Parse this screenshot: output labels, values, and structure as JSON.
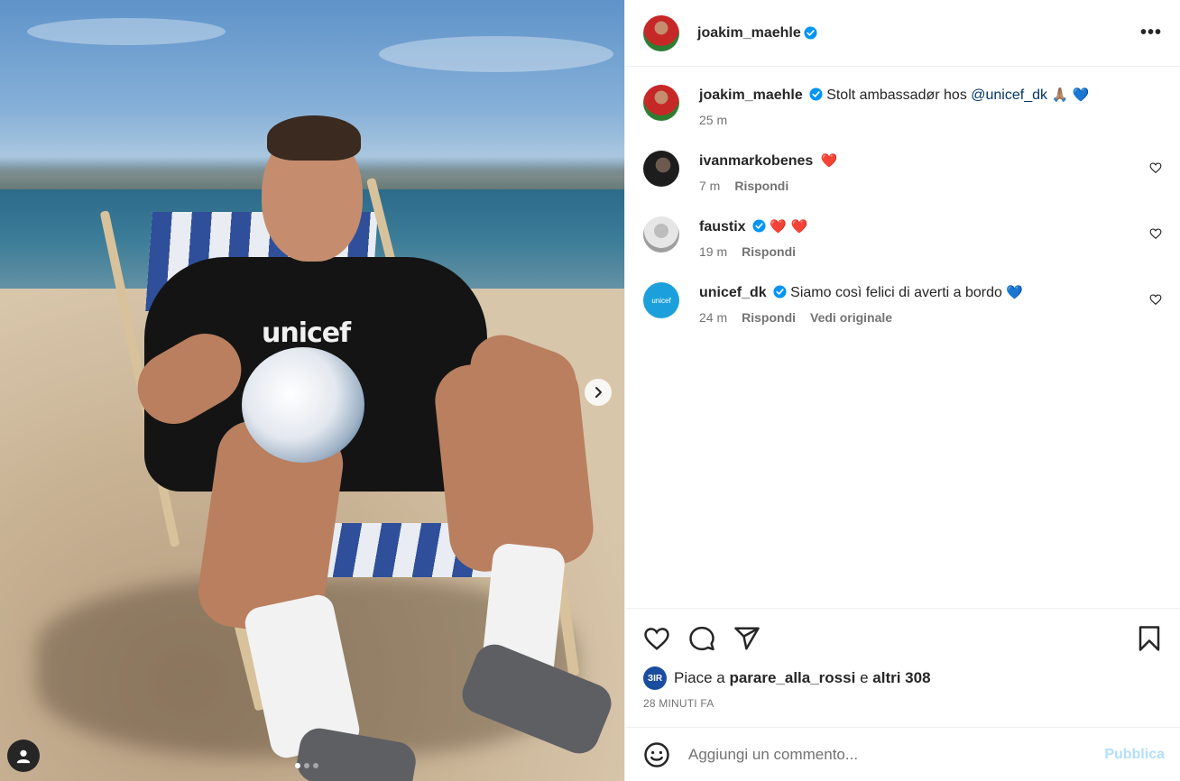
{
  "header": {
    "username": "joakim_maehle",
    "more_label": "•••"
  },
  "caption": {
    "username": "joakim_maehle",
    "text": "Stolt ambassadør hos",
    "mention": "@unicef_dk",
    "emoji": "🙏🏽 💙",
    "time": "25 m"
  },
  "comments": [
    {
      "username": "ivanmarkobenes",
      "text": "",
      "emoji": "❤️",
      "time": "7 m",
      "reply": "Rispondi"
    },
    {
      "username": "faustix",
      "text": "",
      "emoji": "❤️ ❤️",
      "time": "19 m",
      "reply": "Rispondi"
    },
    {
      "username": "unicef_dk",
      "text": "Siamo così felici di averti a bordo",
      "emoji": "💙",
      "time": "24 m",
      "reply": "Rispondi",
      "see_original": "Vedi originale"
    }
  ],
  "media": {
    "shirt_text": "unicef",
    "carousel_count": 3,
    "carousel_active": 0
  },
  "likes": {
    "prefix": "Piace a",
    "user": "parare_alla_rossi",
    "joiner": "e",
    "others": "altri 308",
    "avatar_text": "ЗIR"
  },
  "post_time": "28 MINUTI FA",
  "add_comment": {
    "placeholder": "Aggiungi un commento...",
    "publish": "Pubblica"
  },
  "colors": {
    "verified": "#0095f6",
    "publish_disabled": "#b2dffc",
    "meta_gray": "#737373"
  }
}
